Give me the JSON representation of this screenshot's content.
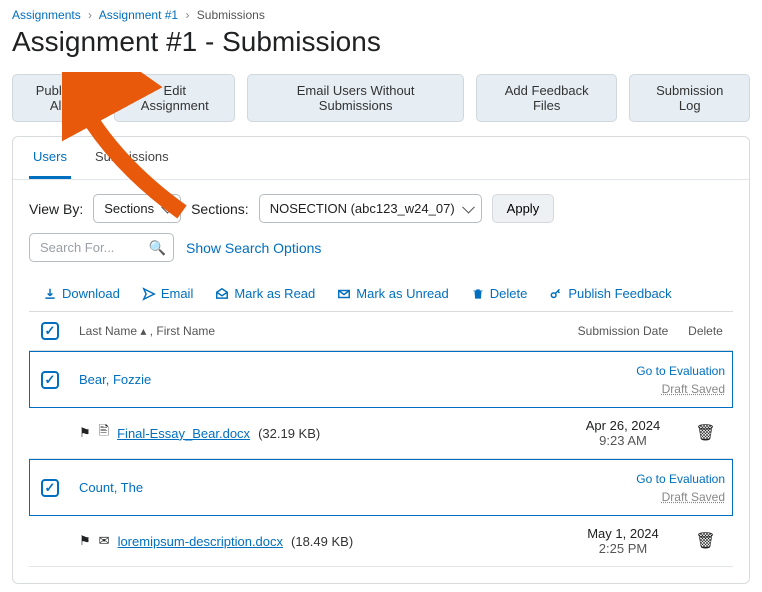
{
  "breadcrumb": {
    "items": [
      "Assignments",
      "Assignment #1"
    ],
    "current": "Submissions"
  },
  "page_title": "Assignment #1 - Submissions",
  "buttons": {
    "publish_all": "Publish All",
    "edit_assignment": "Edit Assignment",
    "email_without": "Email Users Without Submissions",
    "add_feedback": "Add Feedback Files",
    "submission_log": "Submission Log"
  },
  "tabs": {
    "users": "Users",
    "submissions": "Submissions"
  },
  "filters": {
    "view_by_label": "View By:",
    "view_by_value": "Sections",
    "sections_label": "Sections:",
    "sections_value": "NOSECTION (abc123_w24_07)",
    "apply": "Apply"
  },
  "search": {
    "placeholder": "Search For...",
    "show_options": "Show Search Options"
  },
  "actions": {
    "download": "Download",
    "email": "Email",
    "mark_read": "Mark as Read",
    "mark_unread": "Mark as Unread",
    "delete": "Delete",
    "publish_feedback": "Publish Feedback"
  },
  "table": {
    "headers": {
      "name": "Last Name ▴ , First Name",
      "date": "Submission Date",
      "delete": "Delete"
    },
    "eval_link": "Go to Evaluation",
    "draft": "Draft Saved",
    "rows": [
      {
        "name": "Bear, Fozzie",
        "file": "Final-Essay_Bear.docx",
        "size": "(32.19 KB)",
        "date": "Apr 26, 2024",
        "time": "9:23 AM"
      },
      {
        "name": "Count, The",
        "file": "loremipsum-description.docx",
        "size": "(18.49 KB)",
        "date": "May 1, 2024",
        "time": "2:25 PM"
      }
    ]
  }
}
